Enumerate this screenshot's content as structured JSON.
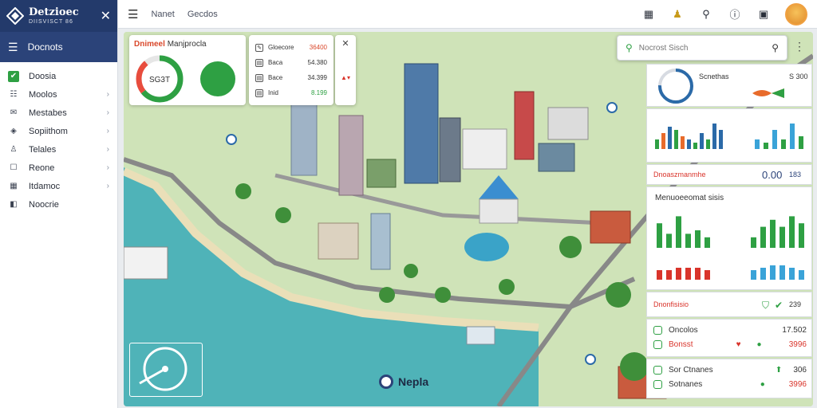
{
  "brand": {
    "title": "Detzioec",
    "subtitle": "DIISVISCT 86",
    "close": "✕"
  },
  "menu": {
    "title": "Docnots"
  },
  "sidebar": {
    "items": [
      {
        "label": "Doosia",
        "icon": "check-icon",
        "active": true,
        "chevron": false
      },
      {
        "label": "Moolos",
        "icon": "list-icon",
        "active": false,
        "chevron": true
      },
      {
        "label": "Mestabes",
        "icon": "chat-icon",
        "active": false,
        "chevron": true
      },
      {
        "label": "Sopiithom",
        "icon": "layers-icon",
        "active": false,
        "chevron": true
      },
      {
        "label": "Telales",
        "icon": "person-icon",
        "active": false,
        "chevron": true
      },
      {
        "label": "Reone",
        "icon": "message-icon",
        "active": false,
        "chevron": true
      },
      {
        "label": "Itdamoc",
        "icon": "calendar-icon",
        "active": false,
        "chevron": true
      },
      {
        "label": "Noocrie",
        "icon": "map-icon",
        "active": false,
        "chevron": false
      }
    ]
  },
  "topbar": {
    "links": [
      "Nanet",
      "Gecdos"
    ]
  },
  "gauge_card": {
    "title_prefix": "Dnimeel",
    "title_rest": "Manjprocla",
    "gauge_value": "SG3T"
  },
  "legend_card": {
    "rows": [
      {
        "label": "Gloecore",
        "value": "36400",
        "valueColor": "#d9482b"
      },
      {
        "label": "Baca",
        "value": "54.380",
        "valueColor": "#333333"
      },
      {
        "label": "Bace",
        "value": "34.399",
        "valueColor": "#333333"
      },
      {
        "label": "Inid",
        "value": "8.199",
        "valueColor": "#2ea043"
      }
    ],
    "close": "✕"
  },
  "search": {
    "placeholder": "Nocrost Sisch"
  },
  "right_panel": {
    "donut_title": "Scnethas",
    "donut_value": "S 300",
    "bars_values_1": [
      0.3,
      0.5,
      0.7,
      0.6,
      0.4,
      0.3,
      0.2,
      0.5,
      0.3,
      0.8,
      0.6
    ],
    "bars_values_2": [
      0.3,
      0.2,
      0.6,
      0.3,
      0.8,
      0.4
    ],
    "section1_title": "Dnoaszmanmhe",
    "section1_value": "0.00",
    "section1_suffix": "183",
    "section2_title": "Menuoeeomat sisis",
    "green_bars_1": [
      0.7,
      0.4,
      0.9,
      0.4,
      0.5,
      0.3
    ],
    "green_bars_2": [
      0.3,
      0.6,
      0.8,
      0.6,
      0.9,
      0.7
    ],
    "red_bars_1": [
      0.4,
      0.4,
      0.5,
      0.5,
      0.5,
      0.4
    ],
    "blue_bars_2": [
      0.4,
      0.5,
      0.6,
      0.6,
      0.5,
      0.4
    ],
    "section3_title": "Dnonfisisio",
    "section3_value": "239",
    "row1": {
      "label": "Oncolos",
      "value": "17.502"
    },
    "row2": {
      "label": "Bonsst",
      "value": "3996"
    },
    "row3": {
      "label": "Sor Ctnanes",
      "value": "306"
    },
    "row4": {
      "label": "Sotnanes",
      "value": "3996"
    }
  },
  "map": {
    "label": "Nepla"
  }
}
